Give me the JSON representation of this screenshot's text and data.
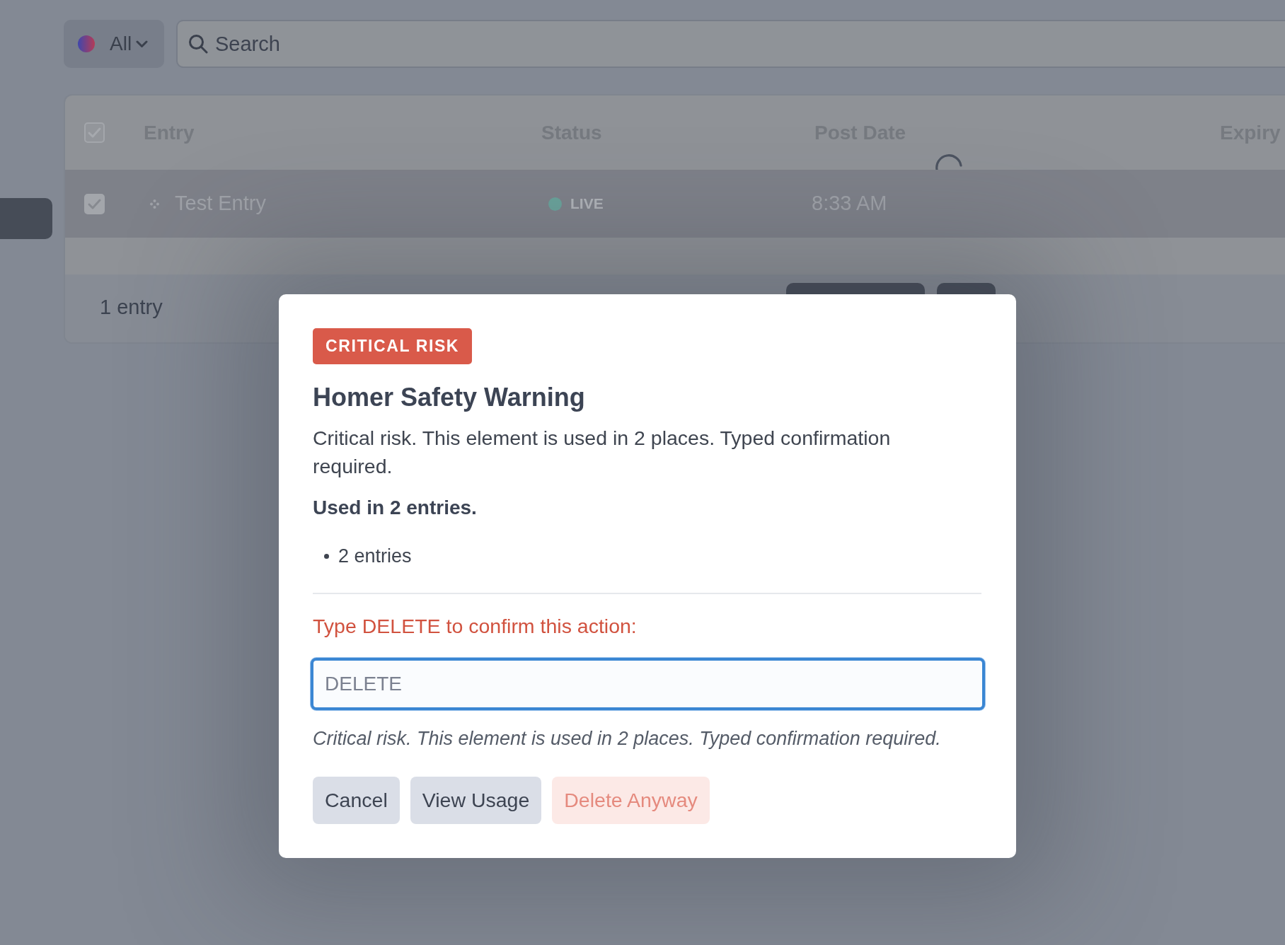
{
  "toolbar": {
    "filter": {
      "label": "All"
    },
    "search": {
      "placeholder": "Search"
    }
  },
  "table": {
    "select_all_checked": true,
    "loading": true,
    "columns": [
      "Entry",
      "Status",
      "Post Date",
      "Expiry"
    ],
    "rows": [
      {
        "entry": "Test Entry",
        "status": "LIVE",
        "post_date": "8:33 AM",
        "checked": true,
        "selected": true
      }
    ],
    "footer": {
      "count": "1 entry"
    }
  },
  "dialog": {
    "badge": "CRITICAL RISK",
    "title": "Homer Safety Warning",
    "message": "Critical risk. This element is used in 2 places. Typed confirmation required.",
    "usage_heading": "Used in 2 entries.",
    "usage_items": [
      "2 entries"
    ],
    "confirm_prompt": "Type DELETE to confirm this action:",
    "confirm_field": {
      "placeholder": "DELETE",
      "focused": true
    },
    "help": "Critical risk. This element is used in 2 places. Typed confirmation required.",
    "buttons": [
      {
        "label": "Cancel",
        "kind": "secondary",
        "disabled": false
      },
      {
        "label": "View Usage",
        "kind": "secondary",
        "disabled": false
      },
      {
        "label": "Delete Anyway",
        "kind": "danger",
        "disabled": true
      }
    ]
  }
}
